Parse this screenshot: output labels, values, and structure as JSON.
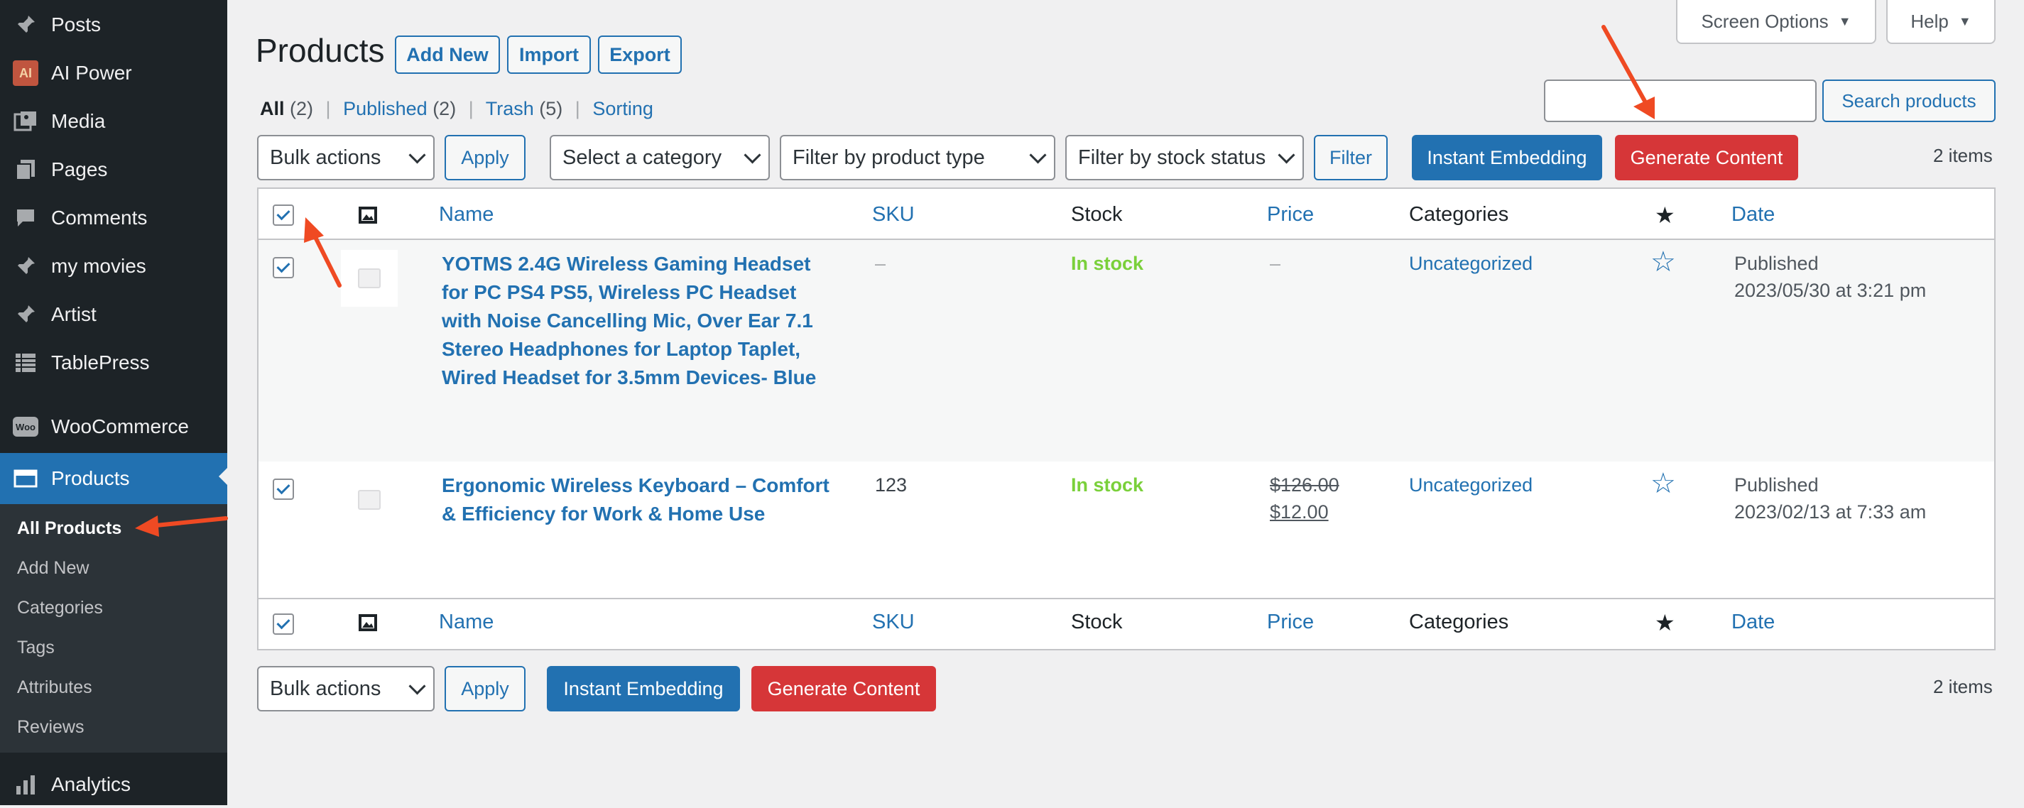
{
  "sidebar": {
    "items": [
      {
        "label": "Posts",
        "icon": "pin-icon"
      },
      {
        "label": "AI Power",
        "icon": "ai-power-icon"
      },
      {
        "label": "Media",
        "icon": "media-icon"
      },
      {
        "label": "Pages",
        "icon": "pages-icon"
      },
      {
        "label": "Comments",
        "icon": "comments-icon"
      },
      {
        "label": "my movies",
        "icon": "pin-icon"
      },
      {
        "label": "Artist",
        "icon": "pin-icon"
      },
      {
        "label": "TablePress",
        "icon": "table-icon"
      },
      {
        "label": "WooCommerce",
        "icon": "woocommerce-icon"
      },
      {
        "label": "Products",
        "icon": "products-icon"
      },
      {
        "label": "Analytics",
        "icon": "analytics-icon"
      }
    ],
    "submenu": [
      "All Products",
      "Add New",
      "Categories",
      "Tags",
      "Attributes",
      "Reviews"
    ],
    "ai_badge": "AI",
    "woo_badge": "Woo"
  },
  "top": {
    "screen_options": "Screen Options",
    "help": "Help"
  },
  "header": {
    "title": "Products",
    "add_new": "Add New",
    "import": "Import",
    "export": "Export"
  },
  "views": {
    "all": "All",
    "all_count": "(2)",
    "published": "Published",
    "published_count": "(2)",
    "trash": "Trash",
    "trash_count": "(5)",
    "sorting": "Sorting",
    "separator": "|"
  },
  "search": {
    "button": "Search products",
    "value": ""
  },
  "filters": {
    "bulk_actions": "Bulk actions",
    "apply": "Apply",
    "category": "Select a category",
    "product_type": "Filter by product type",
    "stock_status": "Filter by stock status",
    "filter": "Filter",
    "instant_embedding": "Instant Embedding",
    "generate_content": "Generate Content",
    "items_count": "2 items"
  },
  "table": {
    "columns": {
      "name": "Name",
      "sku": "SKU",
      "stock": "Stock",
      "price": "Price",
      "categories": "Categories",
      "featured": "★",
      "date": "Date"
    },
    "rows": [
      {
        "name_lines": [
          "YOTMS 2.4G Wireless Gaming Headset",
          "for PC PS4 PS5, Wireless PC Headset",
          "with Noise Cancelling Mic, Over Ear 7.1",
          "Stereo Headphones for Laptop Taplet,",
          "Wired Headset for 3.5mm Devices- Blue"
        ],
        "sku": "–",
        "stock": "In stock",
        "price": "–",
        "category": "Uncategorized",
        "featured": "☆",
        "status": "Published",
        "date": "2023/05/30 at 3:21 pm"
      },
      {
        "name_lines": [
          "Ergonomic Wireless Keyboard – Comfort",
          "& Efficiency for Work & Home Use"
        ],
        "sku": "123",
        "stock": "In stock",
        "price_regular": "$126.00",
        "price_sale": "$12.00",
        "category": "Uncategorized",
        "featured": "☆",
        "status": "Published",
        "date": "2023/02/13 at 7:33 am"
      }
    ]
  },
  "colors": {
    "accent": "#2271b1",
    "danger": "#d63638",
    "sidebar": "#1d2327",
    "in_stock": "#7ad03a",
    "annotation_arrow": "#ef4a23"
  }
}
